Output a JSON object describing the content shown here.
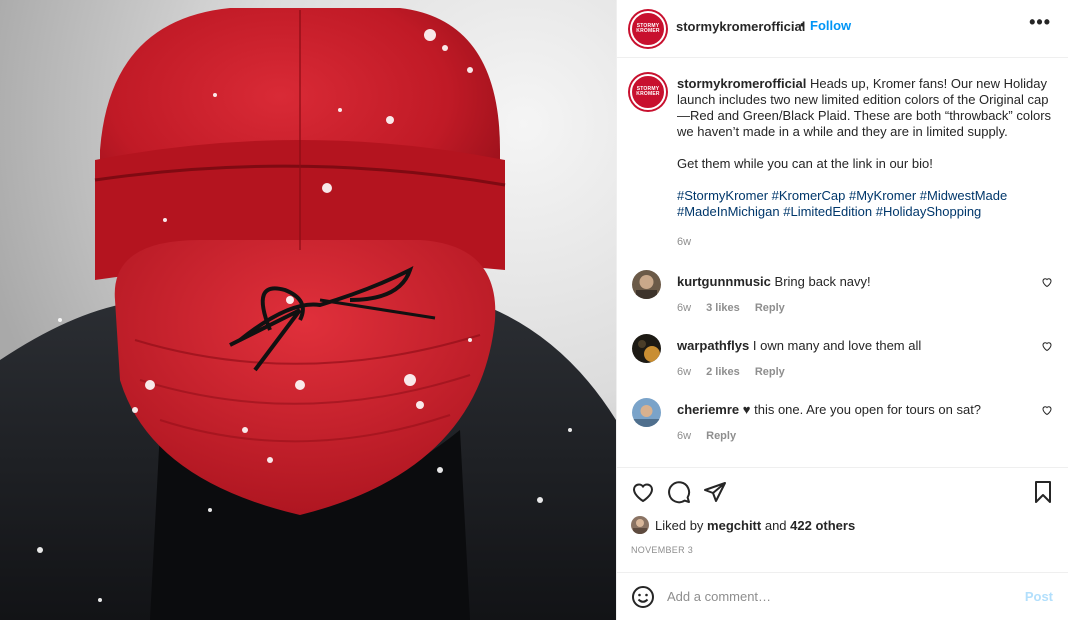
{
  "post": {
    "author": "stormykromerofficial",
    "follow_label": "Follow",
    "separator": "•",
    "more_label": "•••",
    "logo_text": [
      "STORMY",
      "KROMER"
    ]
  },
  "caption": {
    "author": "stormykromerofficial",
    "paragraph1": "Heads up, Kromer fans! Our new Holiday launch includes two new limited edition colors of the Original cap—Red and Green/Black Plaid. These are both “throwback” colors we haven’t made in a while and they are in limited supply.",
    "paragraph2": "Get them while you can at the link in our bio!",
    "hashtags": [
      "#StormyKromer",
      "#KromerCap",
      "#MyKromer",
      "#MidwestMade",
      "#MadeInMichigan",
      "#LimitedEdition",
      "#HolidayShopping"
    ],
    "time": "6w"
  },
  "comments": [
    {
      "user": "kurtgunnmusic",
      "text": "Bring back navy!",
      "time": "6w",
      "likes": "3 likes",
      "reply": "Reply"
    },
    {
      "user": "warpathflys",
      "text": "I own many and love them all",
      "time": "6w",
      "likes": "2 likes",
      "reply": "Reply"
    },
    {
      "user": "cheriemre",
      "text": "♥ this one. Are you open for tours on sat?",
      "time": "6w",
      "likes": "",
      "reply": "Reply"
    }
  ],
  "likes": {
    "prefix": "Liked by",
    "user": "megchitt",
    "and": "and",
    "others": "422 others"
  },
  "date": "NOVEMBER 3",
  "add_comment": {
    "placeholder": "Add a comment…",
    "post_label": "Post"
  },
  "colors": {
    "accent": "#0095f6",
    "cap_red": "#c8102e",
    "hashtag": "#00376b",
    "muted": "#8e8e8e"
  },
  "icons": [
    "heart-icon",
    "comment-icon",
    "share-icon",
    "bookmark-icon",
    "emoji-icon",
    "more-icon"
  ]
}
